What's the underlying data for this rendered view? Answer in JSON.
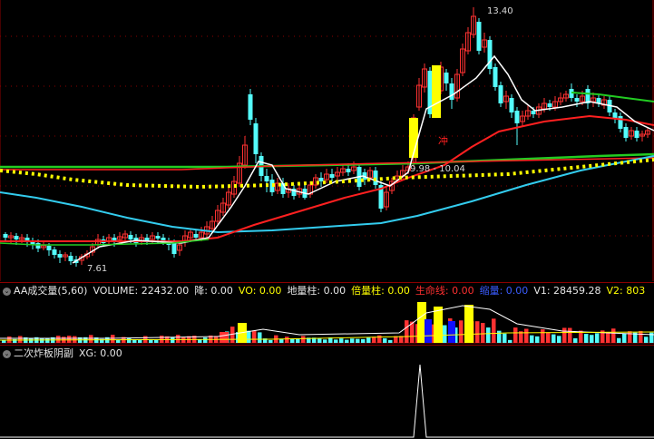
{
  "main_chart": {
    "annotations": {
      "high_price": "13.40",
      "low_price": "7.61",
      "mid_label": "9.98 - 10.04",
      "red_marker": "冲"
    }
  },
  "volume_pane": {
    "title": "AA成交量(5,60)",
    "fields": [
      {
        "label": "VOLUME:",
        "value": "22432.00",
        "color": "white"
      },
      {
        "label": "降:",
        "value": "0.00",
        "color": "white"
      },
      {
        "label": "VO:",
        "value": "0.00",
        "color": "yellow"
      },
      {
        "label": "地量柱:",
        "value": "0.00",
        "color": "white"
      },
      {
        "label": "倍量柱:",
        "value": "0.00",
        "color": "yellow"
      },
      {
        "label": "生命线:",
        "value": "0.00",
        "color": "red"
      },
      {
        "label": "缩量:",
        "value": "0.00",
        "color": "blue"
      },
      {
        "label": "V1:",
        "value": "28459.28",
        "color": "white"
      },
      {
        "label": "V2:",
        "value": "803",
        "color": "yellow"
      }
    ]
  },
  "indicator_pane": {
    "title": "二次炸板阴副",
    "fields": [
      {
        "label": "XG:",
        "value": "0.00",
        "color": "white"
      }
    ]
  },
  "colors": {
    "up_candle": "#ff3232",
    "down_candle": "#54fcfc",
    "ma_white": "#ffffff",
    "ma_red": "#ff2020",
    "ma_green": "#22cc22",
    "ma_cyan": "#33ccee",
    "dots_yellow": "#ffff00",
    "volume_yellow": "#ffff00",
    "volume_blue": "#1010ff"
  }
}
